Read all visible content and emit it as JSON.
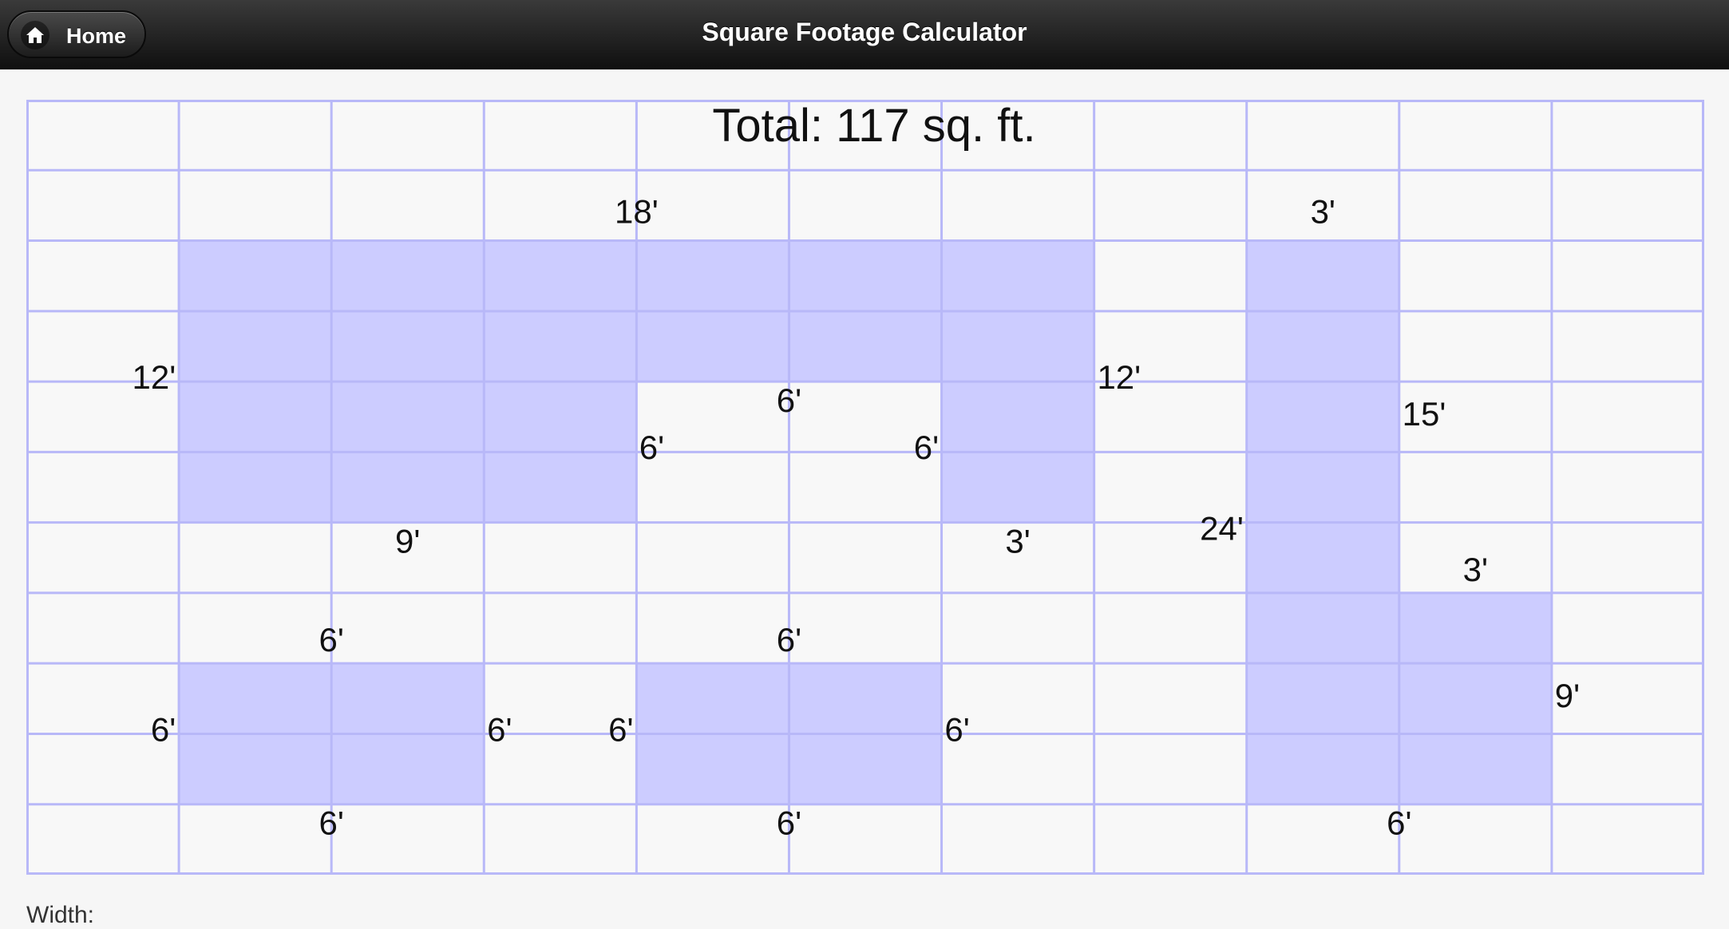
{
  "header": {
    "home_label": "Home",
    "home_icon": "home-icon",
    "title": "Square Footage Calculator"
  },
  "grid": {
    "columns": 11,
    "rows": 11,
    "line_color": "#b8b8f8",
    "fill_color": "#ccccff",
    "shaded_cells": [
      [
        2,
        1
      ],
      [
        2,
        2
      ],
      [
        2,
        3
      ],
      [
        2,
        4
      ],
      [
        2,
        5
      ],
      [
        2,
        6
      ],
      [
        3,
        1
      ],
      [
        3,
        2
      ],
      [
        3,
        3
      ],
      [
        3,
        4
      ],
      [
        3,
        5
      ],
      [
        3,
        6
      ],
      [
        4,
        1
      ],
      [
        4,
        2
      ],
      [
        4,
        3
      ],
      [
        4,
        6
      ],
      [
        5,
        1
      ],
      [
        5,
        2
      ],
      [
        5,
        3
      ],
      [
        5,
        6
      ],
      [
        2,
        8
      ],
      [
        3,
        8
      ],
      [
        4,
        8
      ],
      [
        5,
        8
      ],
      [
        6,
        8
      ],
      [
        7,
        8
      ],
      [
        7,
        9
      ],
      [
        8,
        8
      ],
      [
        8,
        9
      ],
      [
        9,
        8
      ],
      [
        9,
        9
      ],
      [
        8,
        1
      ],
      [
        8,
        2
      ],
      [
        9,
        1
      ],
      [
        9,
        2
      ],
      [
        8,
        4
      ],
      [
        8,
        5
      ],
      [
        9,
        4
      ],
      [
        9,
        5
      ]
    ]
  },
  "total": "Total: 117 sq. ft.",
  "dimension_labels": [
    {
      "text": "18'",
      "col": 4.0,
      "row": 1.75,
      "anchor": "middle"
    },
    {
      "text": "12'",
      "col": 0.98,
      "row": 4.1,
      "anchor": "end"
    },
    {
      "text": "6'",
      "col": 5.0,
      "row": 4.43,
      "anchor": "middle"
    },
    {
      "text": "12'",
      "col": 7.02,
      "row": 4.1,
      "anchor": "start"
    },
    {
      "text": "6'",
      "col": 4.1,
      "row": 5.1,
      "anchor": "middle"
    },
    {
      "text": "6'",
      "col": 5.9,
      "row": 5.1,
      "anchor": "middle"
    },
    {
      "text": "9'",
      "col": 2.5,
      "row": 6.43,
      "anchor": "middle"
    },
    {
      "text": "3'",
      "col": 6.5,
      "row": 6.43,
      "anchor": "middle"
    },
    {
      "text": "3'",
      "col": 8.5,
      "row": 1.75,
      "anchor": "middle"
    },
    {
      "text": "15'",
      "col": 9.02,
      "row": 4.62,
      "anchor": "start"
    },
    {
      "text": "24'",
      "col": 7.98,
      "row": 6.25,
      "anchor": "end"
    },
    {
      "text": "3'",
      "col": 9.5,
      "row": 6.83,
      "anchor": "middle"
    },
    {
      "text": "9'",
      "col": 10.02,
      "row": 8.62,
      "anchor": "start"
    },
    {
      "text": "6'",
      "col": 9.0,
      "row": 10.43,
      "anchor": "middle"
    },
    {
      "text": "6'",
      "col": 2.0,
      "row": 7.83,
      "anchor": "middle"
    },
    {
      "text": "6'",
      "col": 0.98,
      "row": 9.1,
      "anchor": "end"
    },
    {
      "text": "6'",
      "col": 3.02,
      "row": 9.1,
      "anchor": "start"
    },
    {
      "text": "6'",
      "col": 2.0,
      "row": 10.43,
      "anchor": "middle"
    },
    {
      "text": "6'",
      "col": 5.0,
      "row": 7.83,
      "anchor": "middle"
    },
    {
      "text": "6'",
      "col": 3.98,
      "row": 9.1,
      "anchor": "end"
    },
    {
      "text": "6'",
      "col": 6.02,
      "row": 9.1,
      "anchor": "start"
    },
    {
      "text": "6'",
      "col": 5.0,
      "row": 10.43,
      "anchor": "middle"
    }
  ],
  "form": {
    "width_label": "Width:"
  }
}
